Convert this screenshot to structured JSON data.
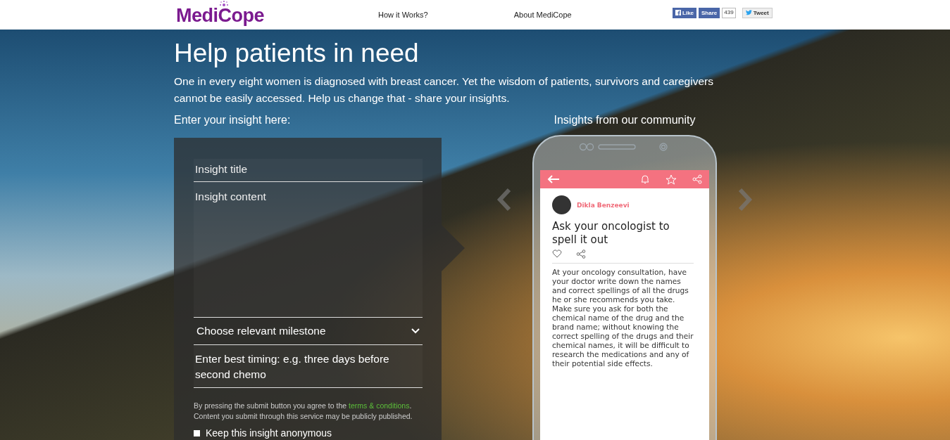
{
  "header": {
    "logo": "MediCope",
    "nav": [
      "How it Works?",
      "About MediCope"
    ],
    "social": {
      "like": "Like",
      "share": "Share",
      "count": "439",
      "tweet": "Tweet"
    }
  },
  "hero": {
    "title": "Help patients in need",
    "subtitle": "One in every eight women is diagnosed with breast cancer. Yet the wisdom of patients, survivors and caregivers cannot be easily accessed. Help us change that - share your insights.",
    "form_heading": "Enter your insight here:",
    "community_heading": "Insights from our community"
  },
  "form": {
    "title_placeholder": "Insight title",
    "content_placeholder": "Insight content",
    "milestone": "Choose relevant milestone",
    "timing_placeholder": "Enter best timing: e.g. three days before second chemo",
    "terms_before": "By pressing the submit button you agree to the ",
    "terms_link": "terms & conditions",
    "terms_after": ".",
    "terms_note": "Content you submit through this service may be publicly published.",
    "anonymous": {
      "label": "Keep this insight anonymous",
      "checked": false
    }
  },
  "insight": {
    "author": "Dikla Benzeevi",
    "title": "Ask your oncologist to spell it out",
    "body": "At your oncology consultation, have your doctor write down the names and correct spellings of all the drugs he or she recommends you take. Make sure you ask for both the chemical name of the drug and the brand name; without knowing the correct spelling of the drugs and their chemical names, it will be difficult to research the medications and any of their potential side effects."
  }
}
